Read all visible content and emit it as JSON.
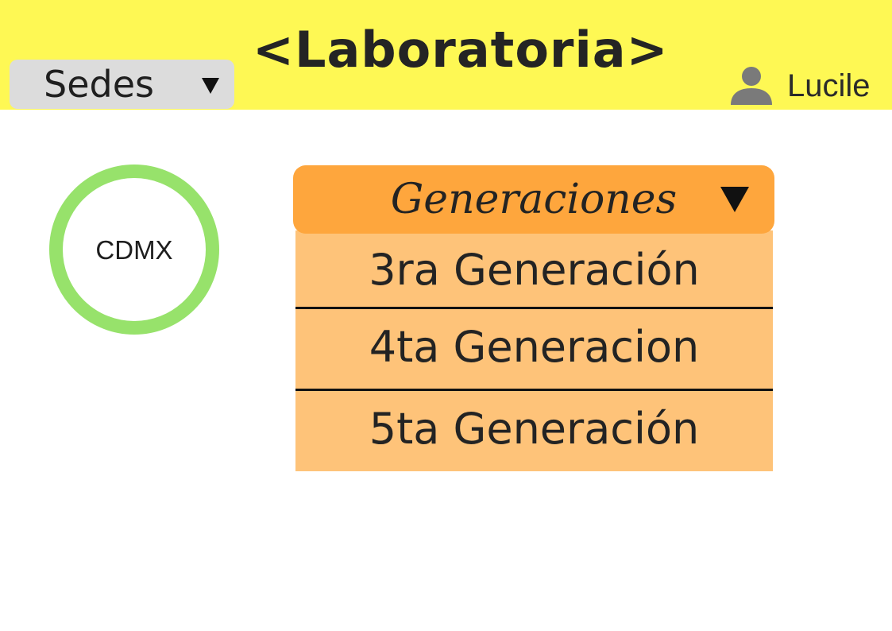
{
  "header": {
    "title": "<Laboratoria>",
    "background_color": "#fef854"
  },
  "sedes_dropdown": {
    "label": "Sedes",
    "icon": "caret-down-icon"
  },
  "user": {
    "name": "Lucile",
    "icon": "user-icon"
  },
  "campus": {
    "label": "CDMX",
    "ring_color": "#97e26b"
  },
  "generations": {
    "header_label": "Generaciones",
    "header_color": "#fea63d",
    "item_color": "#fec379",
    "icon": "caret-down-icon",
    "items": [
      {
        "label": "3ra Generación"
      },
      {
        "label": "4ta Generacion"
      },
      {
        "label": "5ta Generación"
      }
    ]
  }
}
